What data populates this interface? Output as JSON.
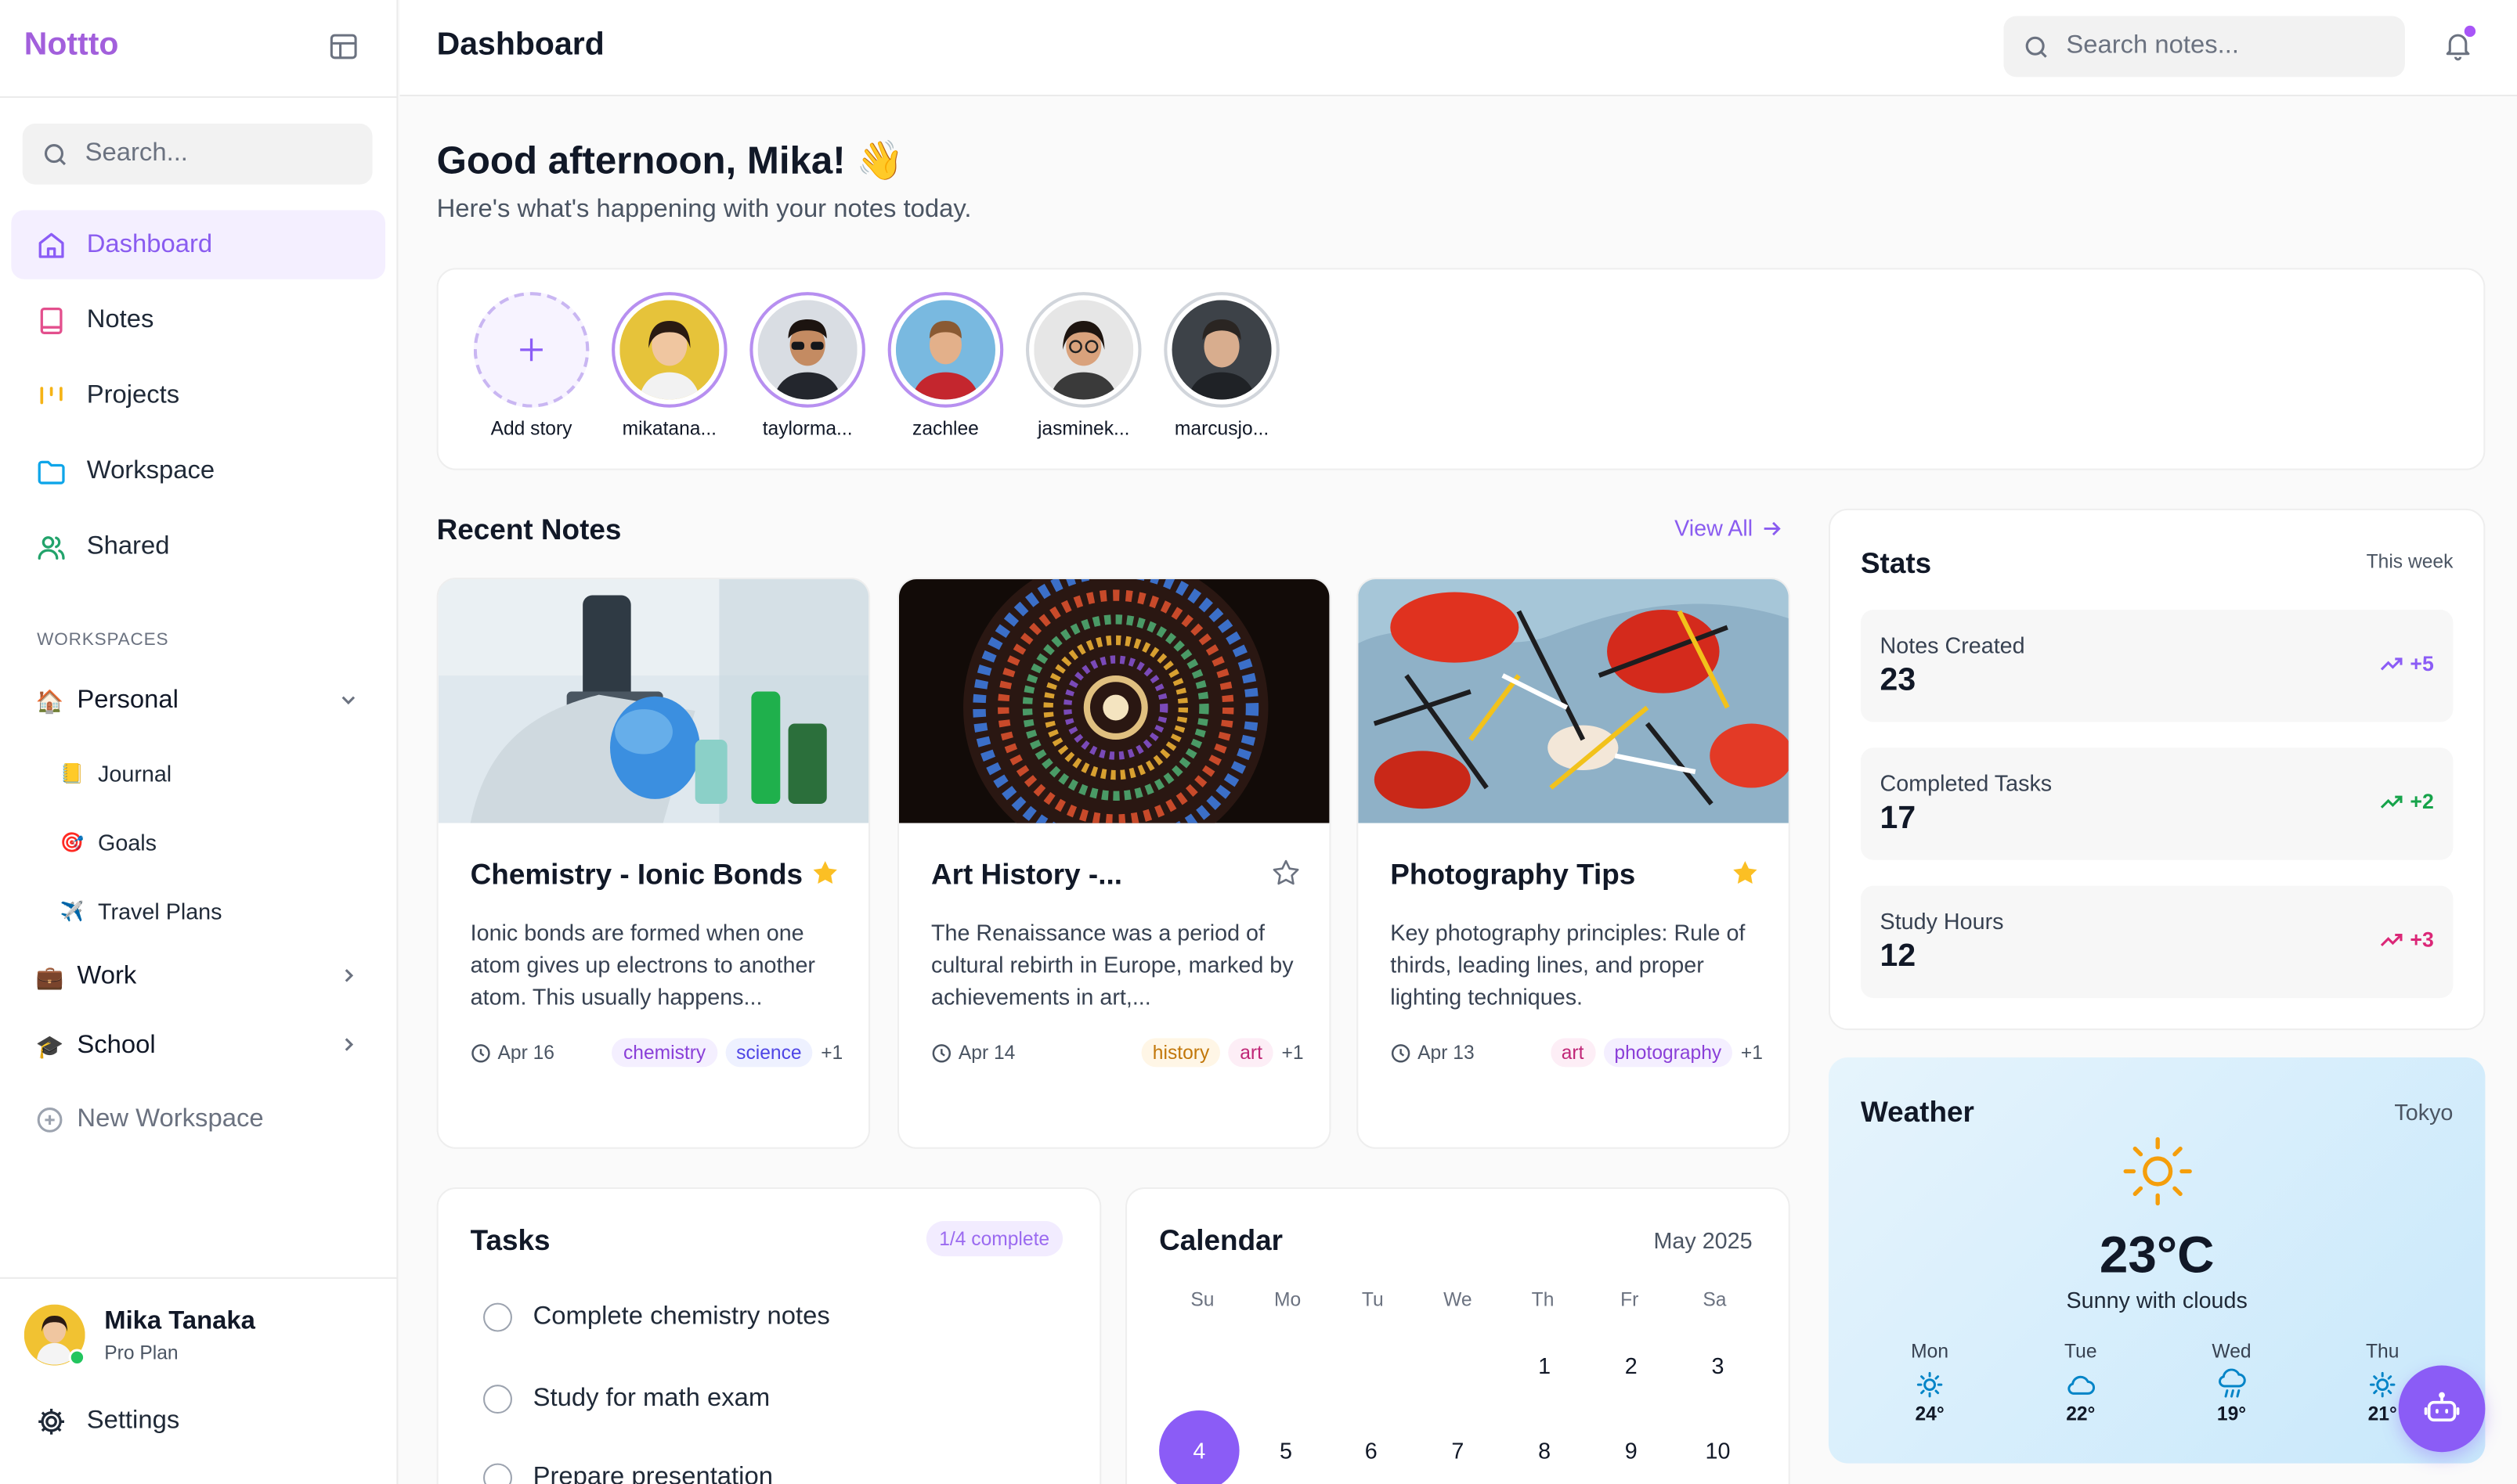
{
  "app": {
    "name": "Nottto"
  },
  "sidebar": {
    "search_placeholder": "Search...",
    "nav": [
      {
        "label": "Dashboard",
        "icon": "home-icon",
        "active": true
      },
      {
        "label": "Notes",
        "icon": "book-icon"
      },
      {
        "label": "Projects",
        "icon": "kanban-icon"
      },
      {
        "label": "Workspace",
        "icon": "folder-icon"
      },
      {
        "label": "Shared",
        "icon": "users-icon"
      }
    ],
    "workspaces_title": "WORKSPACES",
    "workspaces": [
      {
        "emoji": "🏠",
        "label": "Personal",
        "expanded": true
      },
      {
        "emoji": "💼",
        "label": "Work",
        "expanded": false
      },
      {
        "emoji": "🎓",
        "label": "School",
        "expanded": false
      }
    ],
    "personal_children": [
      {
        "emoji": "📒",
        "label": "Journal"
      },
      {
        "emoji": "🎯",
        "label": "Goals"
      },
      {
        "emoji": "✈️",
        "label": "Travel Plans"
      }
    ],
    "new_workspace": "New Workspace",
    "profile": {
      "name": "Mika Tanaka",
      "plan": "Pro Plan"
    },
    "settings": "Settings"
  },
  "header": {
    "title": "Dashboard",
    "search_placeholder": "Search notes..."
  },
  "greeting": {
    "title": "Good afternoon, Mika! 👋",
    "subtitle": "Here's what's happening with your notes today."
  },
  "stories": {
    "add_label": "Add story",
    "users": [
      "mikatana...",
      "taylorma...",
      "zachlee",
      "jasminek...",
      "marcusjo..."
    ]
  },
  "recent_notes": {
    "title": "Recent Notes",
    "view_all": "View All",
    "notes": [
      {
        "title": "Chemistry - Ionic Bonds",
        "starred": true,
        "excerpt": "Ionic bonds are formed when one atom gives up electrons to another atom. This usually happens...",
        "date": "Apr 16",
        "tags": [
          "chemistry",
          "science"
        ],
        "more": "+1"
      },
      {
        "title": "Art History -...",
        "starred": false,
        "excerpt": "The Renaissance was a period of cultural rebirth in Europe, marked by achievements in art,...",
        "date": "Apr 14",
        "tags": [
          "history",
          "art"
        ],
        "more": "+1"
      },
      {
        "title": "Photography Tips",
        "starred": true,
        "excerpt": "Key photography principles: Rule of thirds, leading lines, and proper lighting techniques.",
        "date": "Apr 13",
        "tags": [
          "art",
          "photography"
        ],
        "more": "+1"
      }
    ]
  },
  "stats": {
    "title": "Stats",
    "period": "This week",
    "items": [
      {
        "label": "Notes Created",
        "value": "23",
        "delta": "+5",
        "color": "#8b5cf6"
      },
      {
        "label": "Completed Tasks",
        "value": "17",
        "delta": "+2",
        "color": "#16a34a"
      },
      {
        "label": "Study Hours",
        "value": "12",
        "delta": "+3",
        "color": "#db2777"
      }
    ]
  },
  "weather": {
    "title": "Weather",
    "city": "Tokyo",
    "temp": "23°C",
    "condition": "Sunny with clouds",
    "forecast": [
      {
        "day": "Mon",
        "icon": "sun-icon",
        "temp": "24°"
      },
      {
        "day": "Tue",
        "icon": "cloud-icon",
        "temp": "22°"
      },
      {
        "day": "Wed",
        "icon": "rain-icon",
        "temp": "19°"
      },
      {
        "day": "Thu",
        "icon": "sun-icon",
        "temp": "21°"
      }
    ]
  },
  "tasks": {
    "title": "Tasks",
    "badge": "1/4 complete",
    "items": [
      "Complete chemistry notes",
      "Study for math exam",
      "Prepare presentation"
    ]
  },
  "calendar": {
    "title": "Calendar",
    "month": "May 2025",
    "weekdays": [
      "Su",
      "Mo",
      "Tu",
      "We",
      "Th",
      "Fr",
      "Sa"
    ],
    "week1": [
      "1",
      "2",
      "3"
    ],
    "week2": [
      "4",
      "5",
      "6",
      "7",
      "8",
      "9",
      "10"
    ],
    "today": "4"
  },
  "colors": {
    "accent": "#8b5cf6",
    "logo": "#a25fdc",
    "star": "#fbbf24"
  }
}
